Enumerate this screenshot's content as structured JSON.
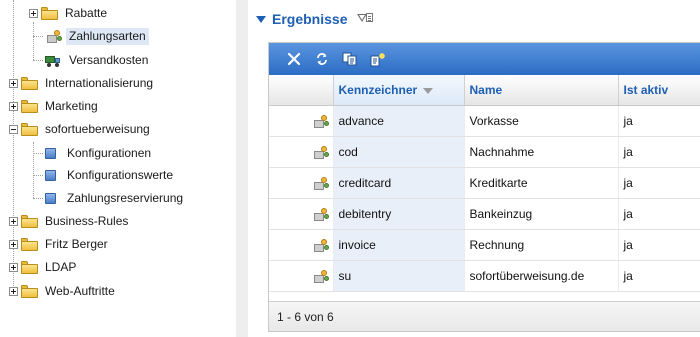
{
  "tree": {
    "items": [
      {
        "label": "Rabatte"
      },
      {
        "label": "Zahlungsarten"
      },
      {
        "label": "Versandkosten"
      },
      {
        "label": "Internationalisierung"
      },
      {
        "label": "Marketing"
      },
      {
        "label": "sofortueberweisung"
      },
      {
        "label": "Konfigurationen"
      },
      {
        "label": "Konfigurationswerte"
      },
      {
        "label": "Zahlungsreservierung"
      },
      {
        "label": "Business-Rules"
      },
      {
        "label": "Fritz Berger"
      },
      {
        "label": "LDAP"
      },
      {
        "label": "Web-Auftritte"
      }
    ],
    "selected": "Zahlungsarten"
  },
  "results": {
    "title": "Ergebnisse",
    "toolbar": {
      "delete_icon": "close-icon",
      "refresh_icon": "refresh-icon",
      "copy_icon": "copy-icon",
      "new_icon": "new-icon"
    },
    "columns": {
      "kennzeichner": "Kennzeichner",
      "name": "Name",
      "ist_aktiv": "Ist aktiv"
    },
    "rows": [
      {
        "key": "advance",
        "name": "Vorkasse",
        "active": "ja"
      },
      {
        "key": "cod",
        "name": "Nachnahme",
        "active": "ja"
      },
      {
        "key": "creditcard",
        "name": "Kreditkarte",
        "active": "ja"
      },
      {
        "key": "debitentry",
        "name": "Bankeinzug",
        "active": "ja"
      },
      {
        "key": "invoice",
        "name": "Rechnung",
        "active": "ja"
      },
      {
        "key": "su",
        "name": "sofortüberweisung.de",
        "active": "ja"
      }
    ],
    "pager": "1 - 6 von 6"
  },
  "colors": {
    "accent": "#1e5fb4",
    "toolbar": "#3d7fd6",
    "selection": "#dde8f4",
    "key_column": "#e8eff9"
  }
}
